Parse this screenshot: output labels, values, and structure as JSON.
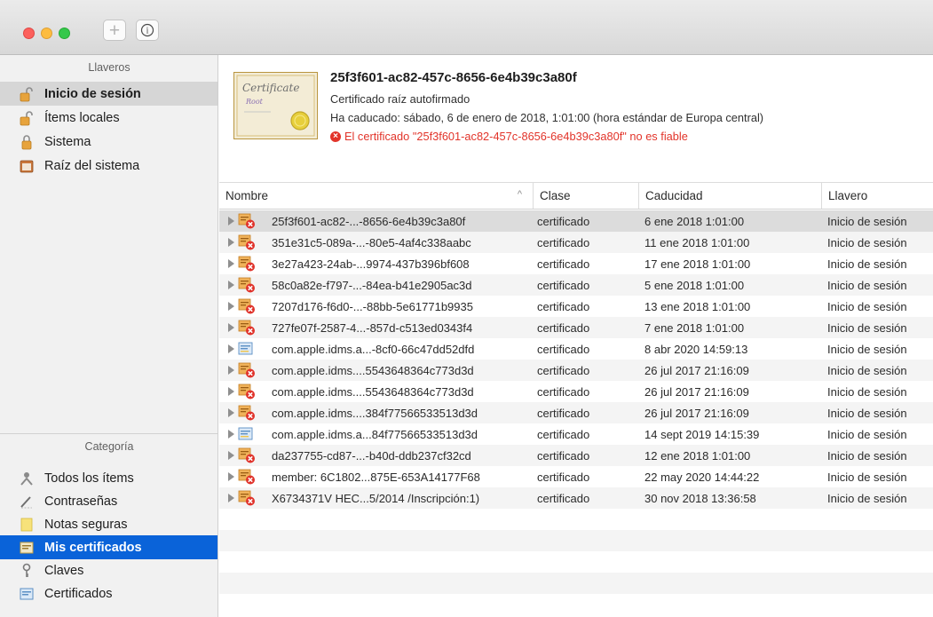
{
  "toolbar": {
    "add_label": "+",
    "info_label": "i"
  },
  "sidebar": {
    "keychains_header": "Llaveros",
    "keychains": [
      {
        "label": "Inicio de sesión",
        "icon": "lock-open-icon",
        "selected": true
      },
      {
        "label": "Ítems locales",
        "icon": "lock-open-icon",
        "selected": false
      },
      {
        "label": "Sistema",
        "icon": "lock-closed-icon",
        "selected": false
      },
      {
        "label": "Raíz del sistema",
        "icon": "cabinet-icon",
        "selected": false
      }
    ],
    "category_header": "Categoría",
    "categories": [
      {
        "label": "Todos los ítems",
        "icon": "people-icon",
        "selected": false
      },
      {
        "label": "Contraseñas",
        "icon": "pen-icon",
        "selected": false
      },
      {
        "label": "Notas seguras",
        "icon": "note-icon",
        "selected": false
      },
      {
        "label": "Mis certificados",
        "icon": "my-certificate-icon",
        "selected": true
      },
      {
        "label": "Claves",
        "icon": "key-icon",
        "selected": false
      },
      {
        "label": "Certificados",
        "icon": "certificate-icon",
        "selected": false
      }
    ]
  },
  "detail": {
    "title": "25f3f601-ac82-457c-8656-6e4b39c3a80f",
    "subtitle": "Certificado raíz autofirmado",
    "expired": "Ha caducado: sábado, 6 de enero de 2018, 1:01:00 (hora estándar de Europa central)",
    "error": "El certificado \"25f3f601-ac82-457c-8656-6e4b39c3a80f\" no es fiable",
    "certificate_image_text": {
      "script": "Certificate",
      "sub": "Root"
    }
  },
  "table": {
    "columns": [
      "Nombre",
      "Clase",
      "Caducidad",
      "Llavero"
    ],
    "rows": [
      {
        "name": "25f3f601-ac82-...-8656-6e4b39c3a80f",
        "class": "certificado",
        "expires": "6 ene 2018 1:01:00",
        "keychain": "Inicio de sesión",
        "invalid": true
      },
      {
        "name": "351e31c5-089a-...-80e5-4af4c338aabc",
        "class": "certificado",
        "expires": "11 ene 2018 1:01:00",
        "keychain": "Inicio de sesión",
        "invalid": true
      },
      {
        "name": "3e27a423-24ab-...9974-437b396bf608",
        "class": "certificado",
        "expires": "17 ene 2018 1:01:00",
        "keychain": "Inicio de sesión",
        "invalid": true
      },
      {
        "name": "58c0a82e-f797-...-84ea-b41e2905ac3d",
        "class": "certificado",
        "expires": "5 ene 2018 1:01:00",
        "keychain": "Inicio de sesión",
        "invalid": true
      },
      {
        "name": "7207d176-f6d0-...-88bb-5e61771b9935",
        "class": "certificado",
        "expires": "13 ene 2018 1:01:00",
        "keychain": "Inicio de sesión",
        "invalid": true
      },
      {
        "name": "727fe07f-2587-4...-857d-c513ed0343f4",
        "class": "certificado",
        "expires": "7 ene 2018 1:01:00",
        "keychain": "Inicio de sesión",
        "invalid": true
      },
      {
        "name": "com.apple.idms.a...-8cf0-66c47dd52dfd",
        "class": "certificado",
        "expires": "8 abr 2020 14:59:13",
        "keychain": "Inicio de sesión",
        "invalid": false
      },
      {
        "name": "com.apple.idms....5543648364c773d3d",
        "class": "certificado",
        "expires": "26 jul 2017 21:16:09",
        "keychain": "Inicio de sesión",
        "invalid": true
      },
      {
        "name": "com.apple.idms....5543648364c773d3d",
        "class": "certificado",
        "expires": "26 jul 2017 21:16:09",
        "keychain": "Inicio de sesión",
        "invalid": true
      },
      {
        "name": "com.apple.idms....384f77566533513d3d",
        "class": "certificado",
        "expires": "26 jul 2017 21:16:09",
        "keychain": "Inicio de sesión",
        "invalid": true
      },
      {
        "name": "com.apple.idms.a...84f77566533513d3d",
        "class": "certificado",
        "expires": "14 sept 2019 14:15:39",
        "keychain": "Inicio de sesión",
        "invalid": false
      },
      {
        "name": "da237755-cd87-...-b40d-ddb237cf32cd",
        "class": "certificado",
        "expires": "12 ene 2018 1:01:00",
        "keychain": "Inicio de sesión",
        "invalid": true
      },
      {
        "name": "member: 6C1802...875E-653A14177F68",
        "class": "certificado",
        "expires": "22 may 2020 14:44:22",
        "keychain": "Inicio de sesión",
        "invalid": true
      },
      {
        "name": "X6734371V HEC...5/2014 /Inscripción:1)",
        "class": "certificado",
        "expires": "30 nov 2018 13:36:58",
        "keychain": "Inicio de sesión",
        "invalid": true
      }
    ]
  },
  "colors": {
    "selection_blue": "#0a63d9",
    "error_red": "#e2342a",
    "sidebar_bg": "#f1f1f1"
  }
}
